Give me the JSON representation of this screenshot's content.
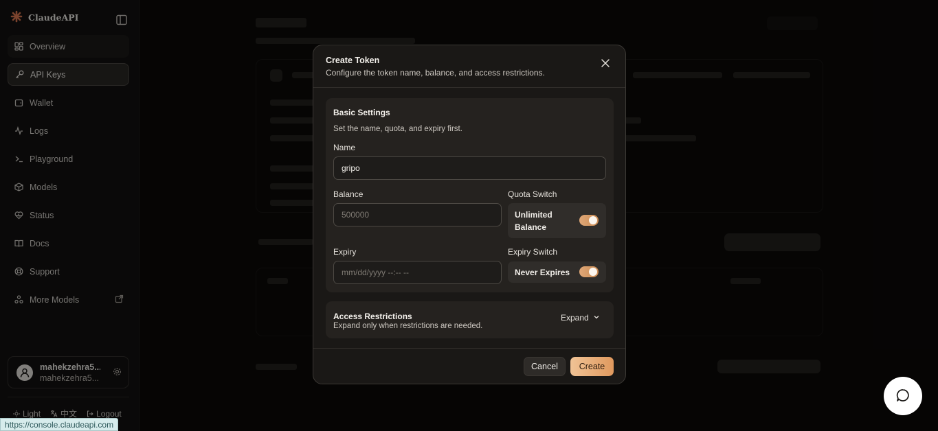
{
  "brand": {
    "name": "ClaudeAPI",
    "accent": "#e07b52"
  },
  "sidebar": {
    "items": [
      {
        "label": "Overview",
        "icon": "dashboard-icon"
      },
      {
        "label": "API Keys",
        "icon": "key-icon"
      },
      {
        "label": "Wallet",
        "icon": "wallet-icon"
      },
      {
        "label": "Logs",
        "icon": "activity-icon"
      },
      {
        "label": "Playground",
        "icon": "terminal-icon"
      },
      {
        "label": "Models",
        "icon": "cube-icon"
      },
      {
        "label": "Status",
        "icon": "heart-pulse-icon"
      },
      {
        "label": "Docs",
        "icon": "book-icon"
      },
      {
        "label": "Support",
        "icon": "lifebuoy-icon"
      },
      {
        "label": "More Models",
        "icon": "network-icon"
      }
    ],
    "active": "API Keys",
    "user": {
      "name": "mahekzehra5...",
      "email": "mahekzehra5..."
    },
    "footer": {
      "theme": "Light",
      "language": "中文",
      "logout": "Logout"
    }
  },
  "status_url": "https://console.claudeapi.com",
  "modal": {
    "title": "Create Token",
    "subtitle": "Configure the token name, balance, and access restrictions.",
    "basic": {
      "title": "Basic Settings",
      "subtitle": "Set the name, quota, and expiry first.",
      "name_label": "Name",
      "name_value": "gripo",
      "balance_label": "Balance",
      "balance_placeholder": "500000",
      "quota_switch_label": "Quota Switch",
      "unlimited_line1": "Unlimited",
      "unlimited_line2": "Balance",
      "unlimited_on": true,
      "expiry_label": "Expiry",
      "expiry_placeholder": "mm/dd/yyyy --:-- --",
      "expiry_switch_label": "Expiry Switch",
      "never_expires": "Never Expires",
      "never_expires_on": true
    },
    "access": {
      "title": "Access Restrictions",
      "subtitle": "Expand only when restrictions are needed.",
      "expand_label": "Expand"
    },
    "cancel_label": "Cancel",
    "create_label": "Create"
  }
}
